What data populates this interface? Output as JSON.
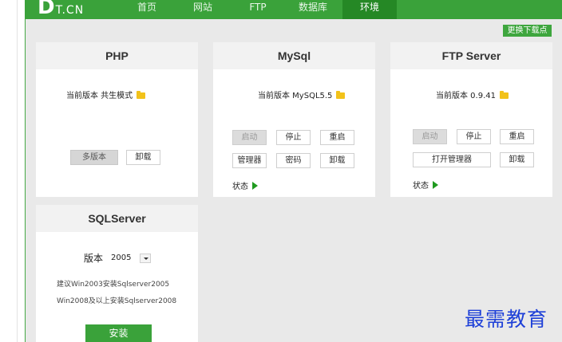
{
  "logo": {
    "main": "D",
    "sub": "T.CN"
  },
  "nav": [
    "首页",
    "网站",
    "FTP",
    "数据库",
    "环境"
  ],
  "change_node": "更换下载点",
  "php": {
    "title": "PHP",
    "version_label": "当前版本 共生模式",
    "multi": "多版本",
    "uninstall": "卸载"
  },
  "mysql": {
    "title": "MySql",
    "version_label": "当前版本 MySQL5.5",
    "start": "启动",
    "stop": "停止",
    "restart": "重启",
    "manager": "管理器",
    "password": "密码",
    "uninstall": "卸载",
    "status": "状态"
  },
  "ftp": {
    "title": "FTP Server",
    "version_label": "当前版本 0.9.41",
    "start": "启动",
    "stop": "停止",
    "restart": "重启",
    "open_manager": "打开管理器",
    "uninstall": "卸载",
    "status": "状态"
  },
  "sqlserver": {
    "title": "SQLServer",
    "version_label": "版本",
    "version_value": "2005",
    "hint1": "建议Win2003安装Sqlserver2005",
    "hint2": "Win2008及以上安装Sqlserver2008",
    "install": "安装"
  },
  "watermark": "最需教育"
}
